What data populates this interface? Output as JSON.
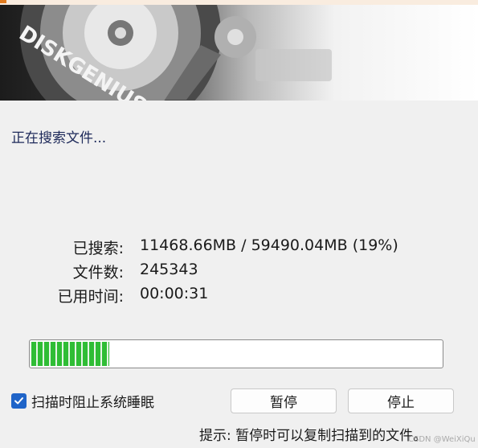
{
  "banner": {
    "logo_text": "DISKGENIUS"
  },
  "status": {
    "text": "正在搜索文件..."
  },
  "info": {
    "searched_label": "已搜索:",
    "searched_value": "11468.66MB / 59490.04MB (19%)",
    "files_label": "文件数:",
    "files_value": "245343",
    "elapsed_label": "已用时间:",
    "elapsed_value": "00:00:31"
  },
  "progress": {
    "fraction": 0.19,
    "color": "#2fbd35"
  },
  "options": {
    "prevent_sleep_label": "扫描时阻止系统睡眠",
    "prevent_sleep_checked": true,
    "checkbox_color": "#1f64c8"
  },
  "buttons": {
    "pause_label": "暂停",
    "stop_label": "停止"
  },
  "hint": {
    "text": "提示: 暂停时可以复制扫描到的文件。"
  },
  "watermark": {
    "text": "CSDN @WeiXiQu"
  },
  "icons": {
    "check": "check-icon"
  }
}
